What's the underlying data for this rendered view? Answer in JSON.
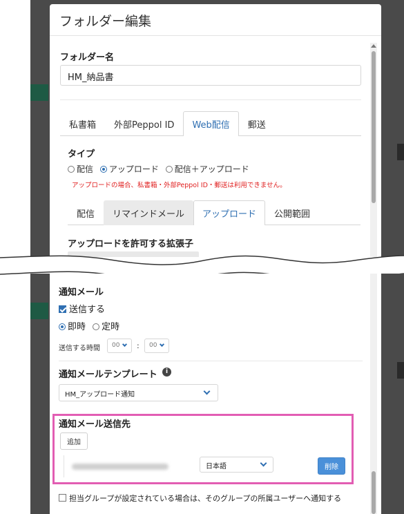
{
  "dialog": {
    "title": "フォルダー編集"
  },
  "folder_name": {
    "label": "フォルダー名",
    "value": "HM_納品書"
  },
  "tabs": [
    {
      "label": "私書箱",
      "active": false
    },
    {
      "label": "外部Peppol ID",
      "active": false
    },
    {
      "label": "Web配信",
      "active": true
    },
    {
      "label": "郵送",
      "active": false
    }
  ],
  "type_section": {
    "label": "タイプ",
    "options": [
      {
        "label": "配信",
        "selected": false
      },
      {
        "label": "アップロード",
        "selected": true
      },
      {
        "label": "配信＋アップロード",
        "selected": false
      }
    ],
    "warning": "アップロードの場合、私書箱・外部Peppol ID・郵送は利用できません。",
    "warning_color": "#e02020"
  },
  "sub_tabs": [
    {
      "label": "配信",
      "active": false
    },
    {
      "label": "リマインドメール",
      "active": false
    },
    {
      "label": "アップロード",
      "active": true
    },
    {
      "label": "公開範囲",
      "active": false
    }
  ],
  "extensions": {
    "label": "アップロードを許可する拡張子"
  },
  "notify": {
    "label": "通知メール",
    "send_label": "送信する",
    "send_checked": true,
    "timing_options": [
      {
        "label": "即時",
        "selected": true
      },
      {
        "label": "定時",
        "selected": false
      }
    ],
    "time_label": "送信する時間",
    "hour": "00",
    "minute": "00",
    "separator": ":"
  },
  "template": {
    "label": "通知メールテンプレート",
    "value": "HM_アップロード通知"
  },
  "recipients": {
    "label": "通知メール送信先",
    "add_label": "追加",
    "language": "日本語",
    "delete_label": "削除",
    "highlight_color": "#e25db3"
  },
  "group_notify": {
    "label": "担当グループが設定されている場合は、そのグループの所属ユーザーへ通知する",
    "checked": false
  },
  "colors": {
    "accent": "#2f6fb2",
    "delete_button": "#4a90d9"
  }
}
